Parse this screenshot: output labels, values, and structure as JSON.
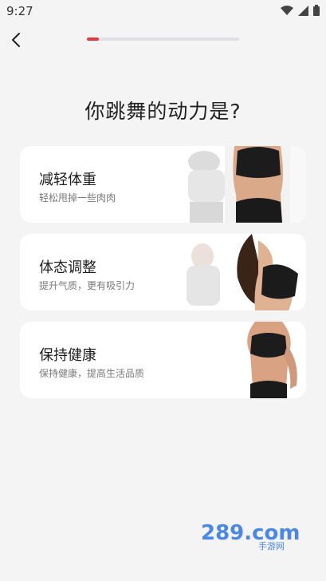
{
  "status_bar": {
    "time": "9:27"
  },
  "progress": {
    "value": 0.08
  },
  "question": "你跳舞的动力是?",
  "options": [
    {
      "title": "减轻体重",
      "subtitle": "轻松甩掉一些肉肉"
    },
    {
      "title": "体态调整",
      "subtitle": "提升气质，更有吸引力"
    },
    {
      "title": "保持健康",
      "subtitle": "保持健康，提高生活品质"
    }
  ],
  "watermark": {
    "main": "289.com",
    "sub": "手游网"
  },
  "colors": {
    "accent": "#e23a3a",
    "background": "#f4f4f5",
    "card": "#ffffff"
  }
}
